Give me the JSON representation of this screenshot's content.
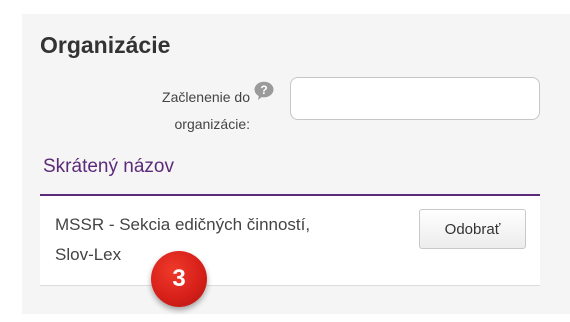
{
  "section": {
    "title": "Organizácie"
  },
  "field": {
    "label_line1": "Začlenenie do",
    "label_line2": "organizácie:",
    "help_icon": "help-bubble-icon",
    "value": "",
    "placeholder": ""
  },
  "table": {
    "column_header": "Skrátený názov",
    "rows": [
      {
        "name_line1": "MSSR - Sekcia edičných činností,",
        "name_line2": "Slov-Lex",
        "remove_label": "Odobrať"
      }
    ]
  },
  "annotation": {
    "step_number": "3",
    "color": "#d8201a"
  },
  "colors": {
    "accent": "#5c2a7a",
    "panel_bg": "#f5f5f5"
  }
}
